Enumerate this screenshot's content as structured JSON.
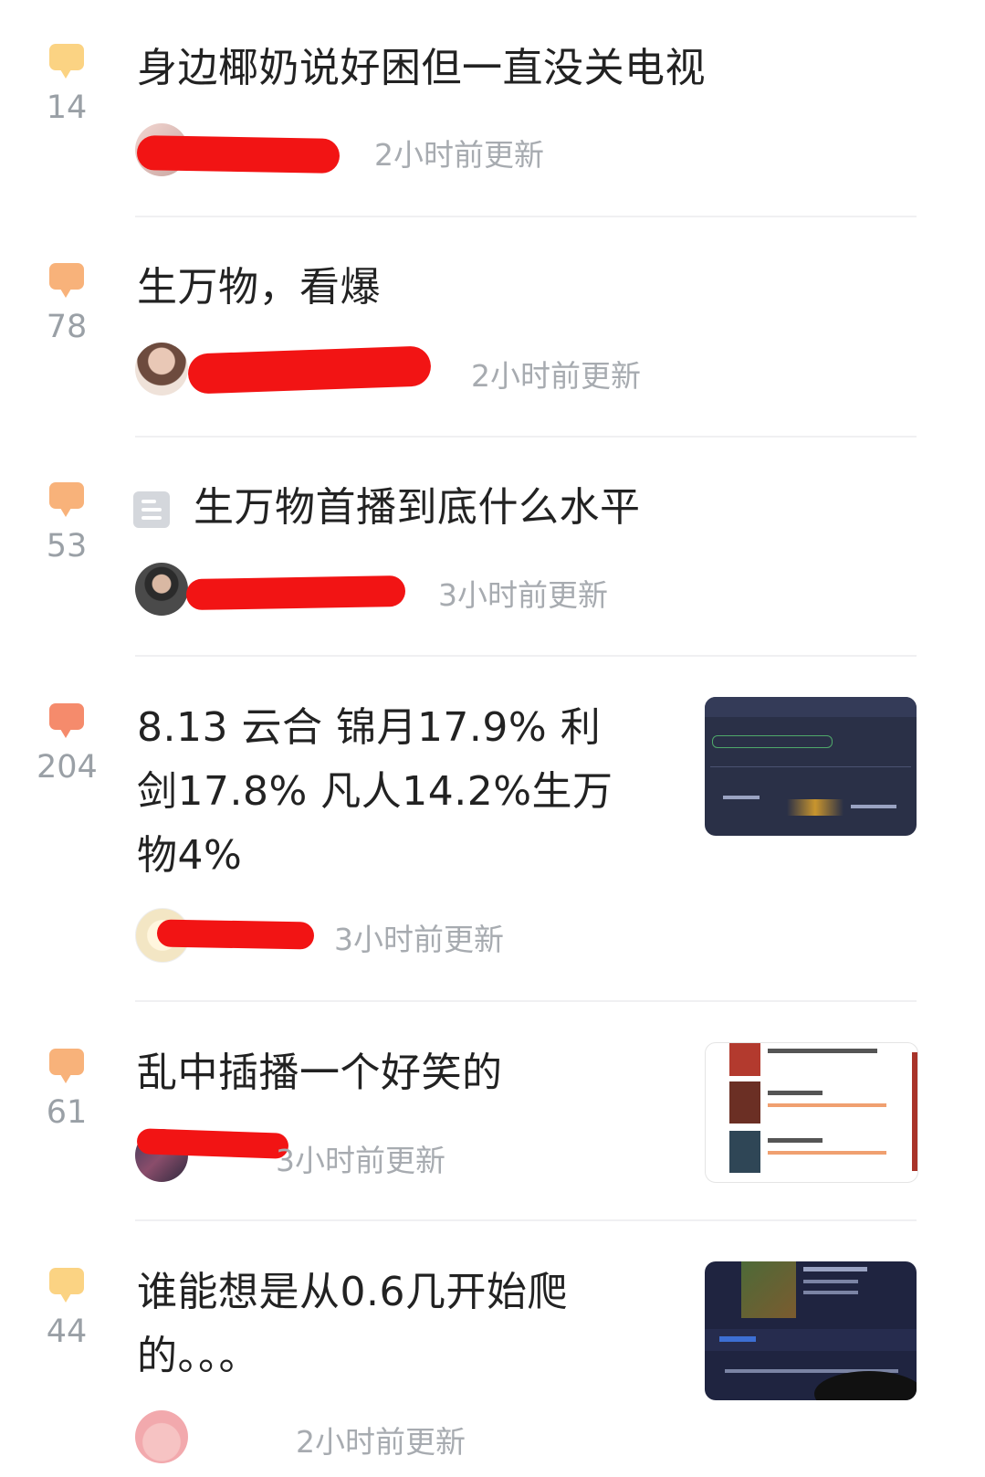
{
  "colors": {
    "bubble_light": "#fbd383",
    "bubble_mid": "#f8b27a",
    "bubble_hot": "#f58b6c",
    "text": "#222222",
    "meta": "#a7abb0",
    "redaction": "#f21414"
  },
  "posts": [
    {
      "title": "身边椰奶说好困但一直没关电视",
      "comments": "14",
      "time": "2小时前更新"
    },
    {
      "title": "生万物，看爆",
      "comments": "78",
      "time": "2小时前更新"
    },
    {
      "title": "生万物首播到底什么水平",
      "comments": "53",
      "time": "3小时前更新",
      "icon": "document-icon"
    },
    {
      "title_lines": [
        "8.13 云合 锦月17.9% 利",
        "剑17.8% 凡人14.2%生万",
        "物4%"
      ],
      "comments": "204",
      "time": "3小时前更新"
    },
    {
      "title": "乱中插播一个好笑的",
      "comments": "61",
      "time": "3小时前更新"
    },
    {
      "title_lines": [
        "谁能想是从0.6几开始爬",
        "的。。。"
      ],
      "comments": "44",
      "time": "2小时前更新"
    }
  ]
}
